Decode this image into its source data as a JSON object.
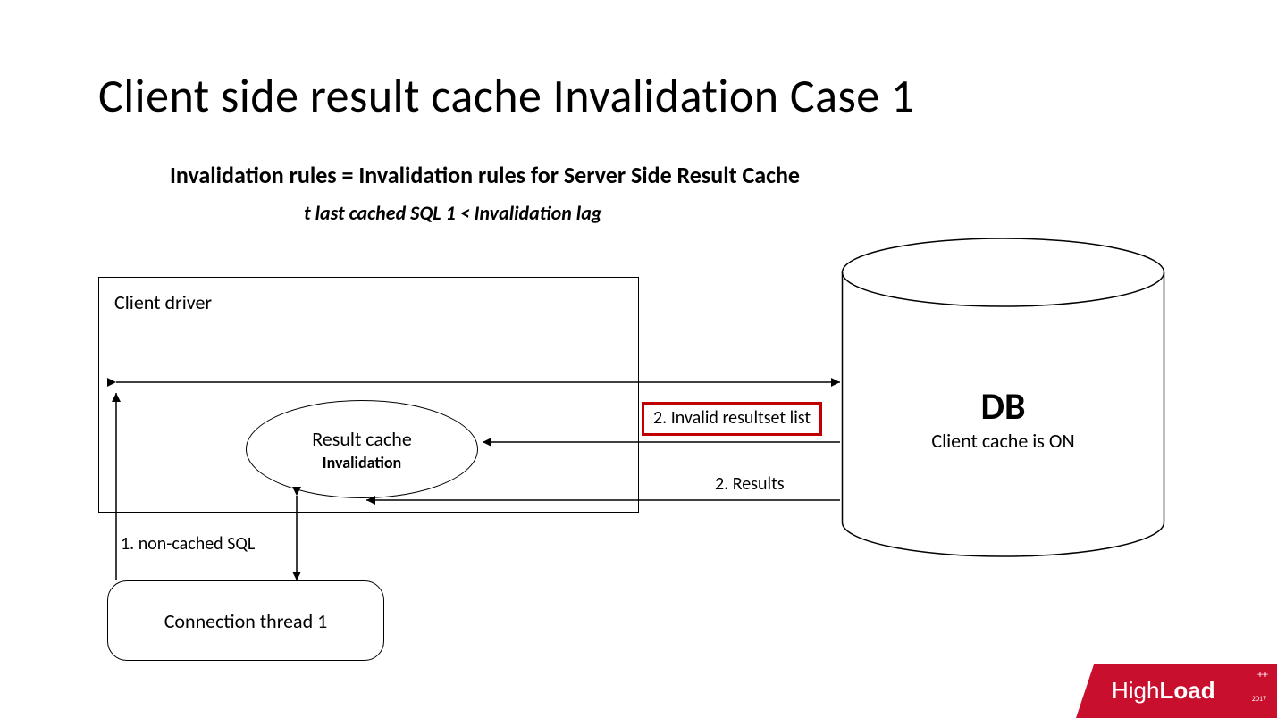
{
  "title": "Client side result cache Invalidation Case 1",
  "subtitle": "Invalidation rules = Invalidation rules for Server Side Result Cache",
  "subnote": "t last cached SQL 1 < Invalidation lag",
  "client_driver_label": "Client driver",
  "result_cache": {
    "line1": "Result cache",
    "line2": "Invalidation"
  },
  "connection_thread": "Connection thread 1",
  "db": {
    "title": "DB",
    "subtitle": "Client cache is ON"
  },
  "labels": {
    "invalid_list": "2. Invalid resultset list",
    "results": "2. Results",
    "noncached": "1. non-cached SQL"
  },
  "logo": {
    "part1": "High",
    "part2": "Load",
    "plus": "++",
    "year": "2017"
  }
}
